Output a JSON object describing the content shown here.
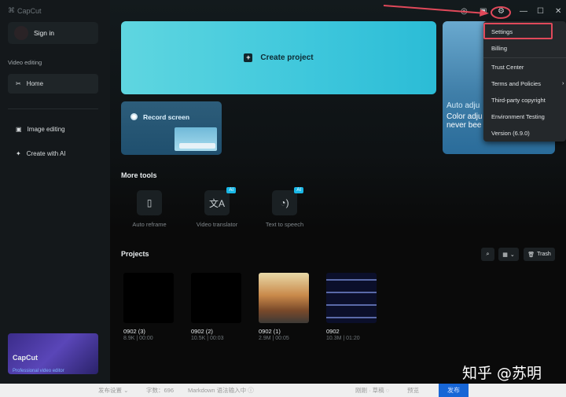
{
  "app": {
    "title": "CapCut"
  },
  "sidebar": {
    "sign_in": "Sign in",
    "section": "Video editing",
    "items": [
      {
        "label": "Home",
        "icon": "scissors-icon"
      },
      {
        "label": "Image editing",
        "icon": "image-icon"
      },
      {
        "label": "Create with AI",
        "icon": "sparkle-icon"
      }
    ],
    "banner": {
      "title": "CapCut",
      "subtitle": "Professional video editor"
    }
  },
  "main": {
    "create_project": "Create project",
    "record_screen": "Record screen",
    "promo": {
      "line1": "Auto adju",
      "line2": "Color adju",
      "line3": "never bee"
    },
    "more_tools": "More tools",
    "tools": [
      {
        "label": "Auto reframe",
        "ai": ""
      },
      {
        "label": "Video translator",
        "ai": "AI"
      },
      {
        "label": "Text to speech",
        "ai": "AI"
      }
    ],
    "projects_title": "Projects",
    "trash": "Trash",
    "projects": [
      {
        "name": "0902 (3)",
        "meta": "8.9K | 00:00"
      },
      {
        "name": "0902 (2)",
        "meta": "10.5K | 00:03"
      },
      {
        "name": "0902 (1)",
        "meta": "2.9M | 00:05"
      },
      {
        "name": "0902",
        "meta": "10.3M | 01:20"
      }
    ]
  },
  "menu": {
    "items": [
      "Settings",
      "Billing",
      "Trust Center",
      "Terms and Policies",
      "Third-party copyright",
      "Environment Testing",
      "Version (6.9.0)"
    ]
  },
  "bottom_bar": {
    "publish_settings": "发布设置 ⌄",
    "word_count": "字数：696",
    "markdown": "Markdown 语法输入中 ⓘ",
    "draft": "刚刚 · 草稿 ◌",
    "preview": "预览",
    "publish": "发布"
  },
  "watermark": "知乎 @苏明",
  "colors": {
    "accent": "#3ec7dc",
    "highlight": "#e0495a",
    "ai_badge": "#19b7e6"
  }
}
